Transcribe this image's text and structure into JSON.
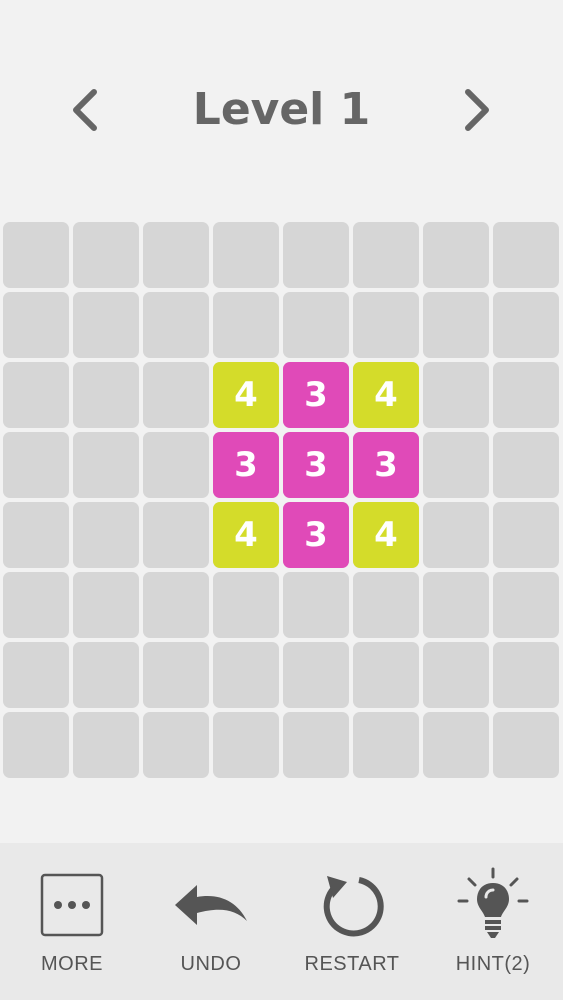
{
  "header": {
    "title": "Level 1",
    "prev_icon": "chevron-left-icon",
    "next_icon": "chevron-right-icon"
  },
  "board": {
    "rows": 8,
    "cols": 8,
    "tiles": [
      {
        "row": 2,
        "col": 3,
        "value": "4",
        "color": "#d4dc2a"
      },
      {
        "row": 2,
        "col": 4,
        "value": "3",
        "color": "#e04ab8"
      },
      {
        "row": 2,
        "col": 5,
        "value": "4",
        "color": "#d4dc2a"
      },
      {
        "row": 3,
        "col": 3,
        "value": "3",
        "color": "#e04ab8"
      },
      {
        "row": 3,
        "col": 4,
        "value": "3",
        "color": "#e04ab8"
      },
      {
        "row": 3,
        "col": 5,
        "value": "3",
        "color": "#e04ab8"
      },
      {
        "row": 4,
        "col": 3,
        "value": "4",
        "color": "#d4dc2a"
      },
      {
        "row": 4,
        "col": 4,
        "value": "3",
        "color": "#e04ab8"
      },
      {
        "row": 4,
        "col": 5,
        "value": "4",
        "color": "#d4dc2a"
      }
    ]
  },
  "toolbar": {
    "more": {
      "label": "MORE",
      "icon": "more-dots-icon"
    },
    "undo": {
      "label": "UNDO",
      "icon": "undo-arrow-icon"
    },
    "restart": {
      "label": "RESTART",
      "icon": "restart-icon"
    },
    "hint": {
      "label": "HINT(2)",
      "icon": "lightbulb-icon"
    }
  },
  "colors": {
    "background": "#f2f2f2",
    "empty_cell": "#d6d6d6",
    "yellow_tile": "#d4dc2a",
    "magenta_tile": "#e04ab8",
    "text": "#666666"
  }
}
